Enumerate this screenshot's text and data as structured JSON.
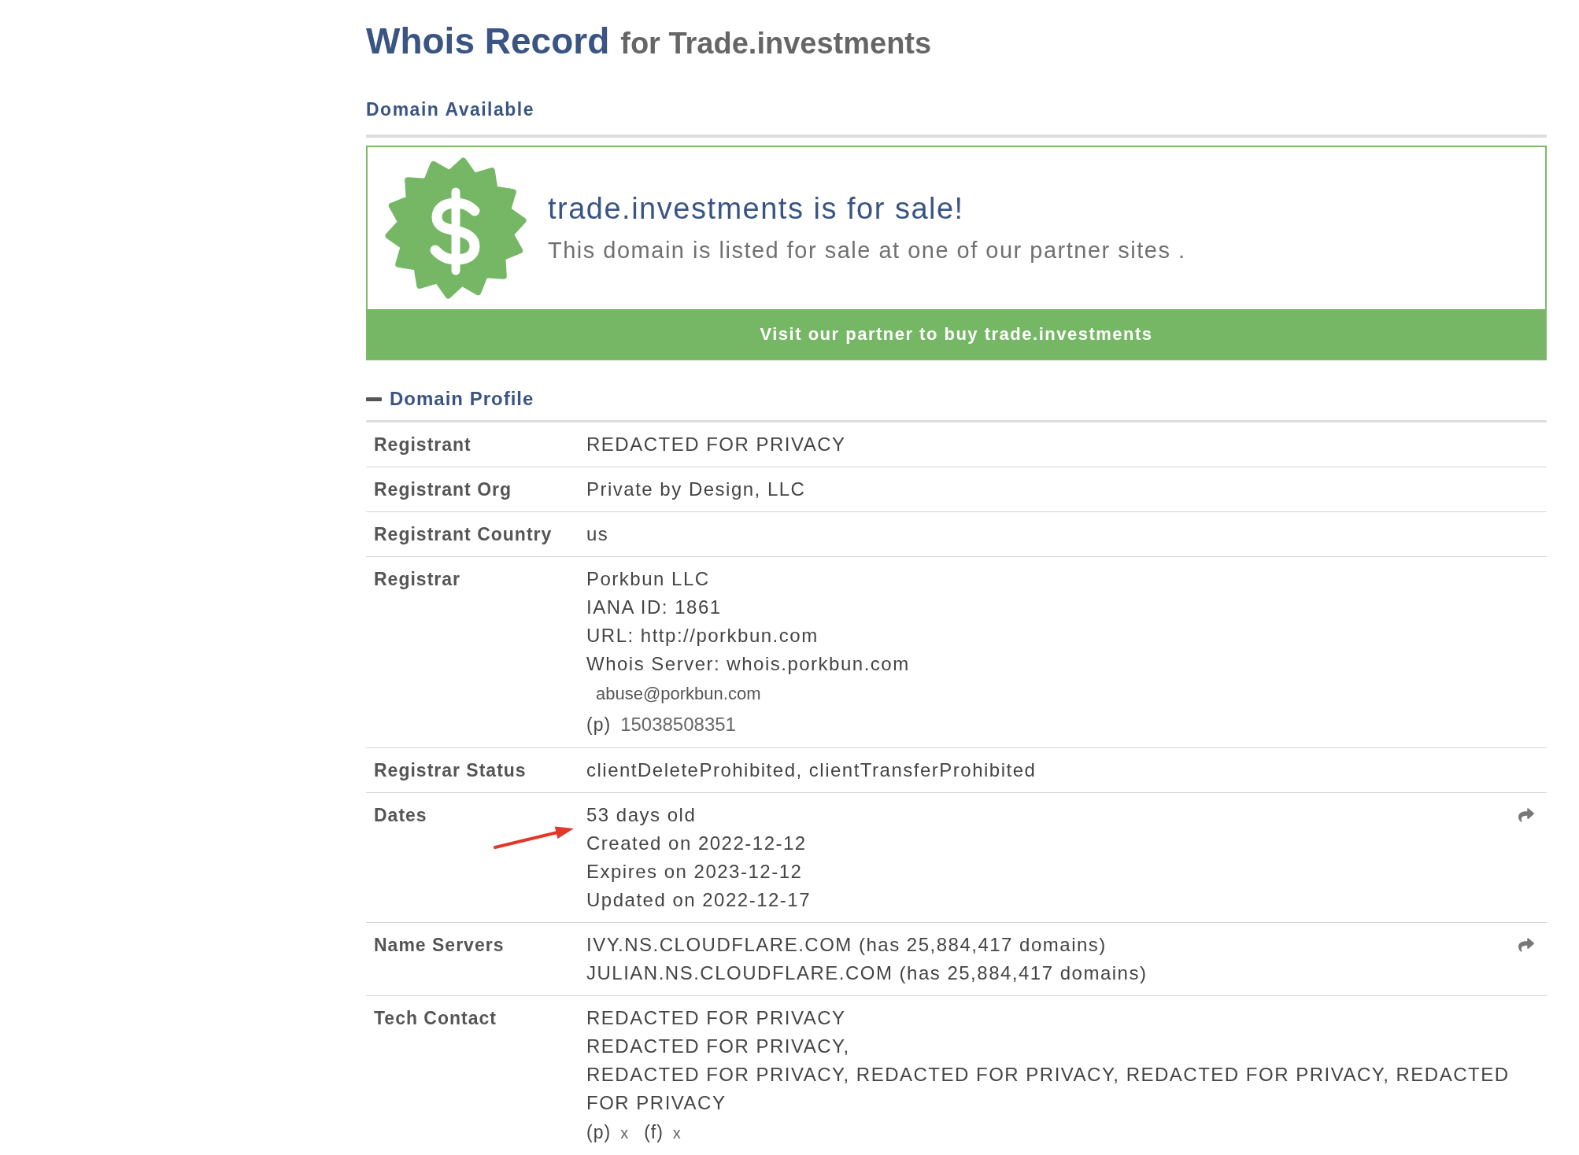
{
  "header": {
    "title": "Whois Record",
    "subtitle": "for Trade.investments"
  },
  "availability": {
    "label": "Domain Available"
  },
  "sale_banner": {
    "heading": "trade.investments is for sale!",
    "text": "This domain is listed for sale at one of our partner sites .",
    "button": "Visit our partner to buy trade.investments"
  },
  "profile": {
    "title": "Domain Profile",
    "expanded": true,
    "rows": [
      {
        "label": "Registrant",
        "share": false,
        "annotation_arrow": false,
        "lines": [
          {
            "kind": "text",
            "text": "REDACTED FOR PRIVACY"
          }
        ]
      },
      {
        "label": "Registrant Org",
        "share": false,
        "annotation_arrow": false,
        "lines": [
          {
            "kind": "text",
            "text": "Private by Design, LLC"
          }
        ]
      },
      {
        "label": "Registrant Country",
        "share": false,
        "annotation_arrow": false,
        "lines": [
          {
            "kind": "text",
            "text": "us"
          }
        ]
      },
      {
        "label": "Registrar",
        "share": false,
        "annotation_arrow": false,
        "lines": [
          {
            "kind": "text",
            "text": "Porkbun LLC"
          },
          {
            "kind": "text",
            "text": "IANA ID: 1861"
          },
          {
            "kind": "text",
            "text": "URL: http://porkbun.com"
          },
          {
            "kind": "text",
            "text": "Whois Server: whois.porkbun.com"
          },
          {
            "kind": "email",
            "text": "abuse@porkbun.com"
          },
          {
            "kind": "contact",
            "parts": [
              {
                "prefix": "(p)",
                "value": "15038508351"
              }
            ]
          }
        ]
      },
      {
        "label": "Registrar Status",
        "share": false,
        "annotation_arrow": false,
        "lines": [
          {
            "kind": "text",
            "text": "clientDeleteProhibited, clientTransferProhibited"
          }
        ]
      },
      {
        "label": "Dates",
        "share": true,
        "annotation_arrow": true,
        "lines": [
          {
            "kind": "text",
            "text": "53 days old"
          },
          {
            "kind": "text",
            "text": "Created on 2022-12-12"
          },
          {
            "kind": "text",
            "text": "Expires on 2023-12-12"
          },
          {
            "kind": "text",
            "text": "Updated on 2022-12-17"
          }
        ]
      },
      {
        "label": "Name Servers",
        "share": true,
        "annotation_arrow": false,
        "lines": [
          {
            "kind": "text",
            "text": "IVY.NS.CLOUDFLARE.COM (has 25,884,417 domains)"
          },
          {
            "kind": "text",
            "text": "JULIAN.NS.CLOUDFLARE.COM (has 25,884,417 domains)"
          }
        ]
      },
      {
        "label": "Tech Contact",
        "share": false,
        "annotation_arrow": false,
        "lines": [
          {
            "kind": "text",
            "text": "REDACTED FOR PRIVACY"
          },
          {
            "kind": "text",
            "text": "REDACTED FOR PRIVACY,"
          },
          {
            "kind": "text",
            "text": "REDACTED FOR PRIVACY, REDACTED FOR PRIVACY, REDACTED FOR PRIVACY, REDACTED FOR PRIVACY"
          },
          {
            "kind": "contact",
            "parts": [
              {
                "prefix": "(p)",
                "value": "x"
              },
              {
                "prefix": "(f)",
                "value": "x"
              }
            ]
          }
        ]
      }
    ]
  }
}
